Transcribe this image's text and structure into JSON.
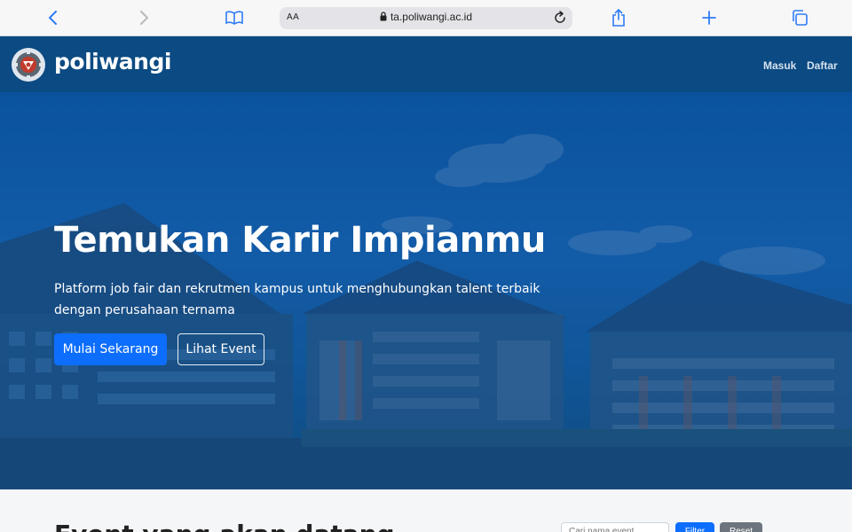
{
  "browser": {
    "aa_label": "AA",
    "url": "ta.poliwangi.ac.id"
  },
  "header": {
    "brand": "poliwangi",
    "nav": {
      "login": "Masuk",
      "register": "Daftar"
    }
  },
  "hero": {
    "title": "Temukan Karir Impianmu",
    "subtitle": "Platform job fair dan rekrutmen kampus untuk menghubungkan talent terbaik dengan perusahaan ternama",
    "primary_button": "Mulai Sekarang",
    "secondary_button": "Lihat Event"
  },
  "events": {
    "heading": "Event yang akan datang",
    "search_placeholder": "Cari nama event…",
    "filter_button": "Filter",
    "reset_button": "Reset"
  },
  "colors": {
    "header_bg": "#0b4a82",
    "primary": "#0d6efd",
    "secondary": "#6c757d"
  },
  "icons": [
    "back-icon",
    "forward-icon",
    "book-icon",
    "lock-icon",
    "reload-icon",
    "share-icon",
    "plus-icon",
    "tabs-icon",
    "poliwangi-logo"
  ]
}
